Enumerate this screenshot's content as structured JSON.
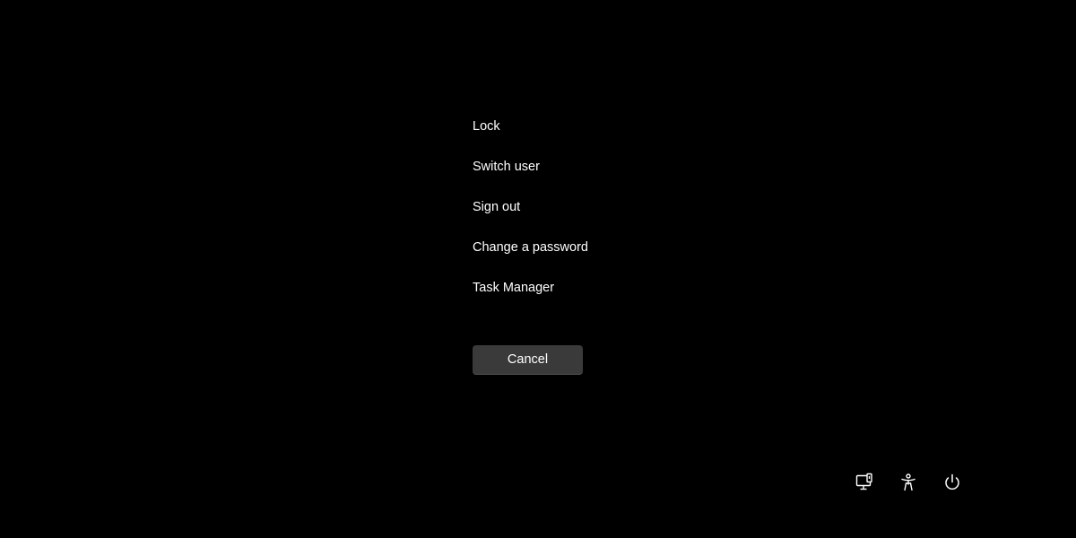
{
  "menu": {
    "items": [
      {
        "label": "Lock"
      },
      {
        "label": "Switch user"
      },
      {
        "label": "Sign out"
      },
      {
        "label": "Change a password"
      },
      {
        "label": "Task Manager"
      }
    ]
  },
  "cancel": {
    "label": "Cancel"
  },
  "system_icons": [
    {
      "icon": "network-icon"
    },
    {
      "icon": "accessibility-icon"
    },
    {
      "icon": "power-icon"
    }
  ],
  "colors": {
    "background": "#000000",
    "text": "#ffffff",
    "button": "#3a3a3a"
  }
}
